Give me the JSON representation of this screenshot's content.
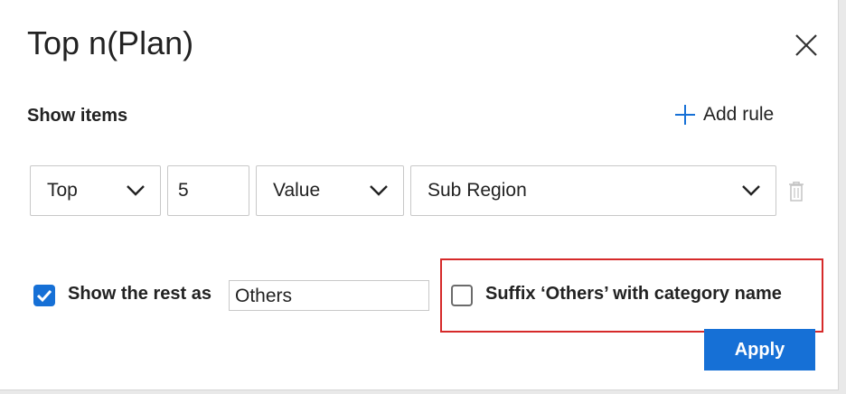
{
  "dialog": {
    "title": "Top n(Plan)",
    "close_icon": "close-icon"
  },
  "rules": {
    "section_label": "Show items",
    "add_rule_label": "Add rule",
    "add_icon": "plus-icon",
    "rule": {
      "direction": "Top",
      "count": "5",
      "measure": "Value",
      "field": "Sub Region",
      "delete_icon": "trash-icon"
    }
  },
  "rest": {
    "checked": true,
    "label": "Show the rest as",
    "value": "Others"
  },
  "suffix": {
    "checked": false,
    "label": "Suffix ‘Others’ with category name"
  },
  "apply_label": "Apply",
  "colors": {
    "accent": "#1670d6",
    "highlight": "#d62a2a"
  }
}
